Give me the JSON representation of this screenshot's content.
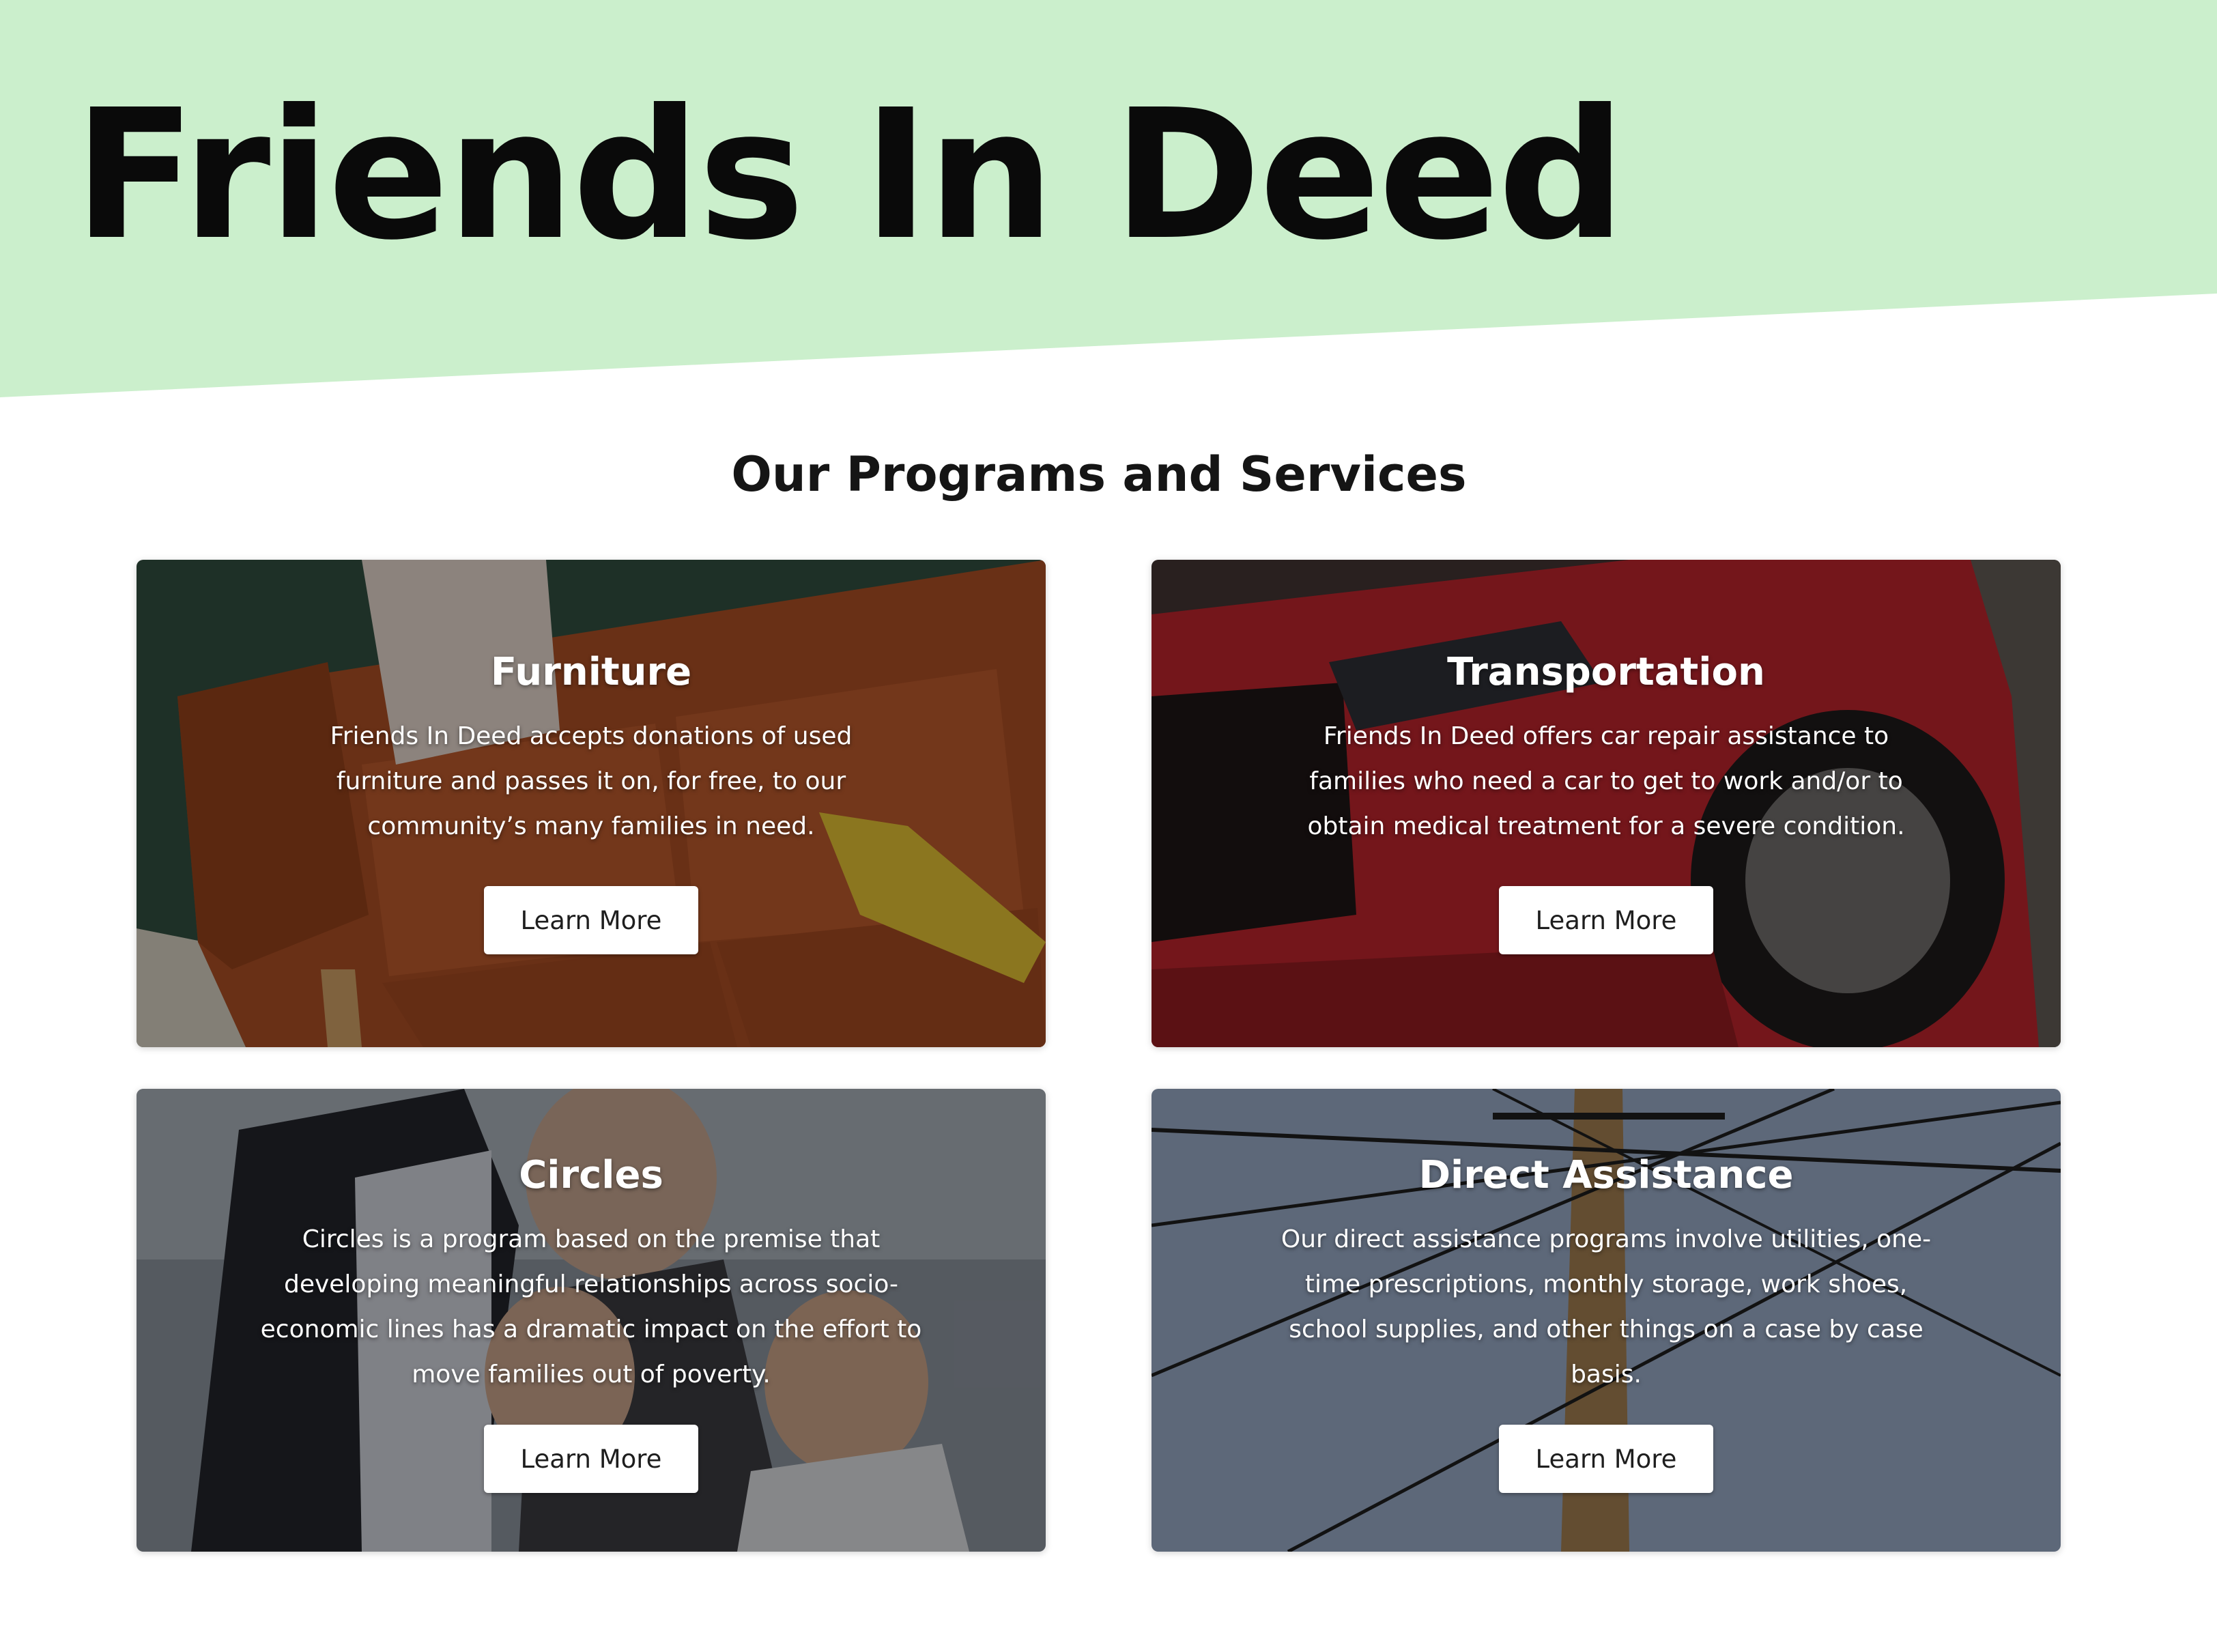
{
  "site": {
    "title": "Friends In Deed",
    "banner_color": "#cbefcc"
  },
  "programs": {
    "heading": "Our Programs and Services",
    "cards": [
      {
        "title": "Furniture",
        "text": "Friends In Deed accepts donations of used furniture and passes it on, for free, to our community’s many families in need.",
        "button": "Learn More",
        "image": "orange-sofa-photo"
      },
      {
        "title": "Transportation",
        "text": "Friends In Deed offers car repair assistance to families who need a car to get to work and/or to obtain medical treatment for a severe condition.",
        "button": "Learn More",
        "image": "red-car-photo"
      },
      {
        "title": "Circles",
        "text": "Circles is a program  based on the premise that developing meaningful relationships across socio-economic lines has a dramatic impact on the effort to move families out of poverty.",
        "button": "Learn More",
        "image": "family-photo"
      },
      {
        "title": "Direct Assistance",
        "text": "Our direct assistance programs involve utilities, one-time prescriptions, monthly storage, work shoes, school supplies, and other things on a case by case basis.",
        "button": "Learn More",
        "image": "utility-pole-photo"
      }
    ]
  }
}
